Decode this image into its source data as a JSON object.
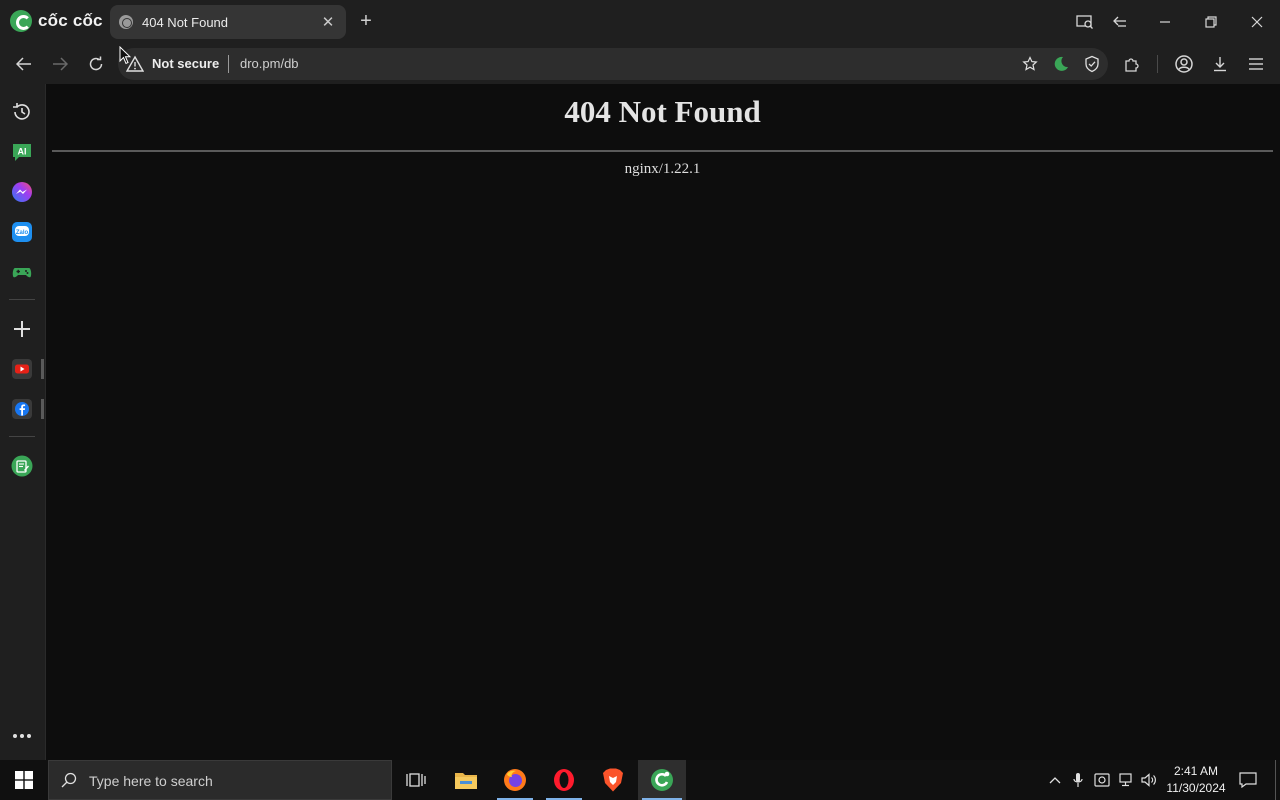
{
  "browser": {
    "brand": "cốc cốc",
    "tab": {
      "title": "404 Not Found"
    },
    "address": {
      "security": "Not secure",
      "url": "dro.pm/db"
    }
  },
  "page": {
    "heading": "404 Not Found",
    "server": "nginx/1.22.1"
  },
  "sidebar": {
    "items": [
      "history-icon",
      "ai-chat-icon",
      "messenger-icon",
      "zalo-icon",
      "games-icon",
      "add-icon",
      "youtube-icon",
      "facebook-icon",
      "notes-icon",
      "more-icon"
    ]
  },
  "taskbar": {
    "search_placeholder": "Type here to search",
    "time": "2:41 AM",
    "date": "11/30/2024"
  },
  "colors": {
    "accent_green": "#3aa657",
    "page_background": "#0d0d0d",
    "chrome_background": "#1f1f1f"
  }
}
